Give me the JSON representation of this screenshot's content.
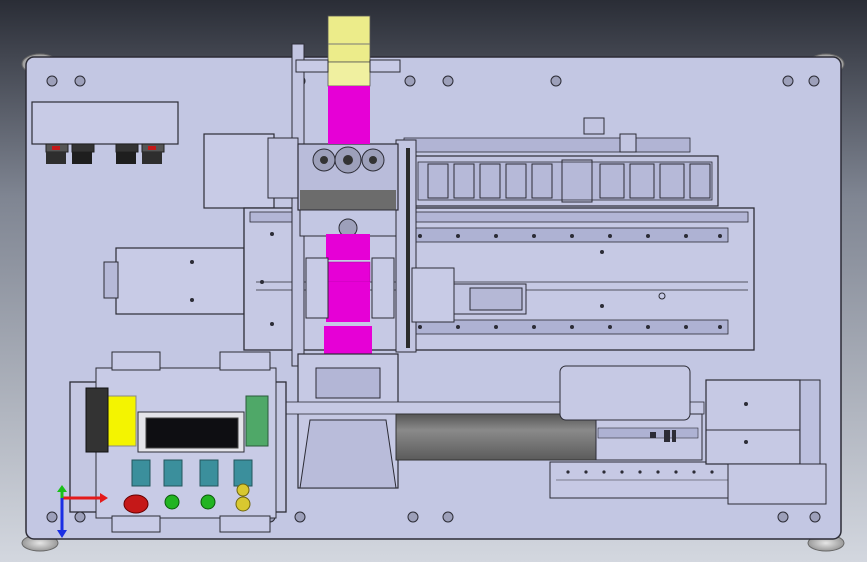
{
  "view": {
    "background_top": "#2a2d36",
    "background_bottom": "#d3d7df",
    "model_fill": "#c3c7e3",
    "model_edge": "#2c2c36",
    "accent_magenta": "#e600d6",
    "accent_yellow": "#ecec8a",
    "accent_yellow_bright": "#f4f400",
    "roller_gray": "#6f6f6f",
    "panel_green": "#4fa868",
    "button_red": "#c51818",
    "button_green": "#22b422",
    "button_teal": "#3b8f9c",
    "lamp_amber": "#d8c830"
  },
  "components": {
    "control_panel": {
      "buttons": [
        "emergency-stop",
        "start",
        "reset",
        "pilot-lamp"
      ]
    },
    "cable_chain_links": 11
  },
  "triad": {
    "x_axis_color": "#e41a1a",
    "y_axis_color": "#19c019",
    "z_axis_color": "#1a2ee4"
  }
}
